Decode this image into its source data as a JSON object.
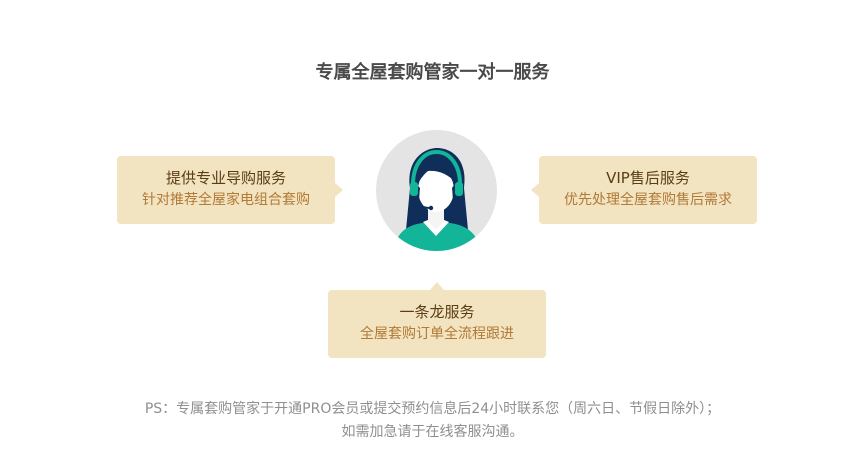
{
  "title": "专属全屋套购管家一对一服务",
  "services": {
    "left": {
      "title": "提供专业导购服务",
      "desc": "针对推荐全屋家电组合套购"
    },
    "right": {
      "title": "VIP售后服务",
      "desc": "优先处理全屋套购售后需求"
    },
    "bottom": {
      "title": "一条龙服务",
      "desc": "全屋套购订单全流程跟进"
    }
  },
  "avatar": {
    "icon": "customer-service-agent-icon"
  },
  "footnote": {
    "line1": "PS：专属套购管家于开通PRO会员或提交预约信息后24小时联系您（周六日、节假日除外）；",
    "line2": "如需加急请于在线客服沟通。"
  },
  "colors": {
    "bubble_bg": "#f2e3c1",
    "headset_teal": "#13b598",
    "avatar_circle": "#e4e4e4"
  }
}
